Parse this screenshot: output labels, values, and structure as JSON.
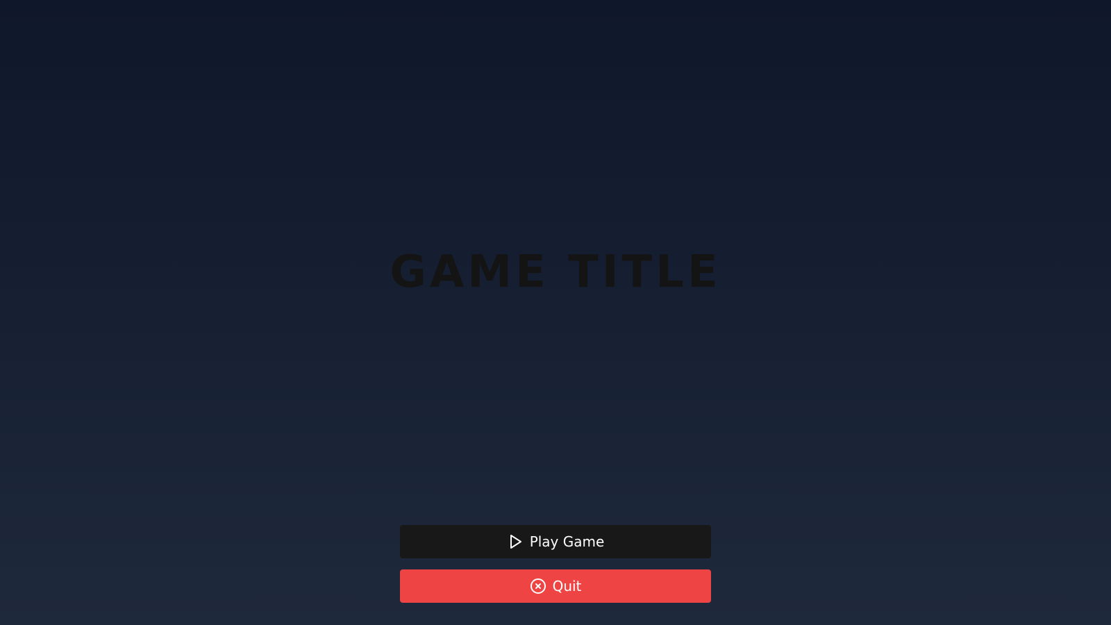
{
  "game": {
    "title": "GAME TITLE"
  },
  "menu": {
    "play_label": "Play Game",
    "play_icon": "play-icon",
    "quit_label": "Quit",
    "quit_icon": "close-circle-icon"
  },
  "colors": {
    "background_top": "#0f172a",
    "background_bottom": "#1e293b",
    "title_text": "#141414",
    "play_button": "#181818",
    "quit_button": "#ef4444",
    "button_text": "#ffffff"
  }
}
